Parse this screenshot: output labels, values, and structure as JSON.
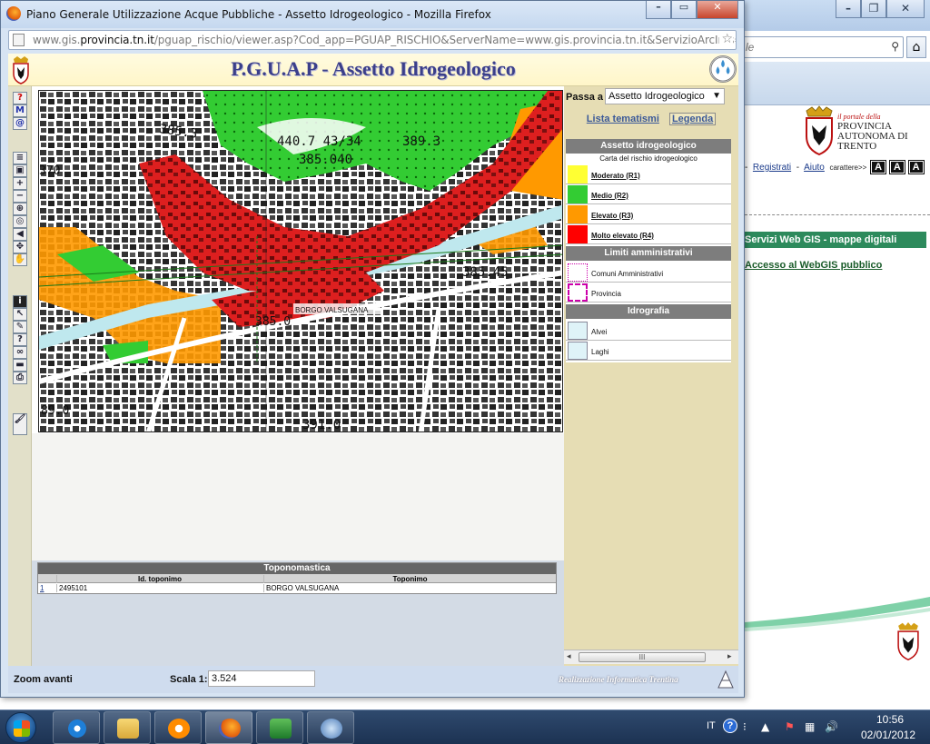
{
  "popup": {
    "title": "Piano Generale Utilizzazione Acque Pubbliche - Assetto Idrogeologico - Mozilla Firefox",
    "url_prefix": "www.gis.",
    "url_domain": "provincia.tn.it",
    "url_rest": "/pguap_rischio/viewer.asp?Cod_app=PGUAP_RISCHIO&ServerName=www.gis.provincia.tn.it&ServizioArcIms=PGUAP_RI"
  },
  "gis": {
    "title": "P.G.U.A.P - Assetto Idrogeologico",
    "passa_label": "Passa a",
    "passa_value": "Assetto Idrogeologico",
    "tab_lista": "Lista tematismi",
    "tab_legenda": "Legenda",
    "map_labels": {
      "elev1": "385.3",
      "elev2": "440.7 43/34",
      "elev3": "389.3",
      "elev4": "385.040",
      "elev5": "385.45",
      "elev6": "385.0",
      "elev7": "391.0",
      "elev8": "89.0",
      "elev9": "370",
      "place": "BORGO VALSUGANA"
    }
  },
  "legend": {
    "section1": "Assetto idrogeologico",
    "section1_sub": "Carta del rischio idrogeologico",
    "items1": [
      {
        "label": "Moderato (R1)",
        "color": "#ffff33"
      },
      {
        "label": "Medio (R2)",
        "color": "#33cc33"
      },
      {
        "label": "Elevato (R3)",
        "color": "#ff9900"
      },
      {
        "label": "Molto elevato (R4)",
        "color": "#ff0000"
      }
    ],
    "section2": "Limiti amministrativi",
    "items2": [
      {
        "label": "Comuni Amministrativi"
      },
      {
        "label": "Provincia"
      }
    ],
    "section3": "Idrografia",
    "items3": [
      {
        "label": "Alvei",
        "color": "#dff3f8"
      },
      {
        "label": "Laghi",
        "color": "#dff3f8"
      }
    ],
    "scroll_mark": "III"
  },
  "toponomastica": {
    "title": "Toponomastica",
    "col1": "Id. toponimo",
    "col2": "Toponimo",
    "rows": [
      {
        "n": "1",
        "id": "2495101",
        "name": "BORGO VALSUGANA"
      }
    ]
  },
  "status": {
    "zoom": "Zoom avanti",
    "scala_label": "Scala 1:",
    "scala_value": "3.524",
    "credit": "Realizzazione Informatica Trentina"
  },
  "bg_page": {
    "search_placeholder": "le",
    "portal_small": "il portale della",
    "portal_name": "PROVINCIA AUTONOMA DI TRENTO",
    "registrati": "Registrati",
    "aiuto": "Aiuto",
    "caratteri": "carattere>>",
    "a_buttons": [
      "A",
      "A",
      "A"
    ],
    "servizi": "Servizi Web GIS - mappe digitali",
    "accesso": "Accesso al WebGIS pubblico",
    "sep1": "-",
    "sep2": "-"
  },
  "taskbar": {
    "lang": "IT",
    "time": "10:56",
    "date": "02/01/2012"
  }
}
